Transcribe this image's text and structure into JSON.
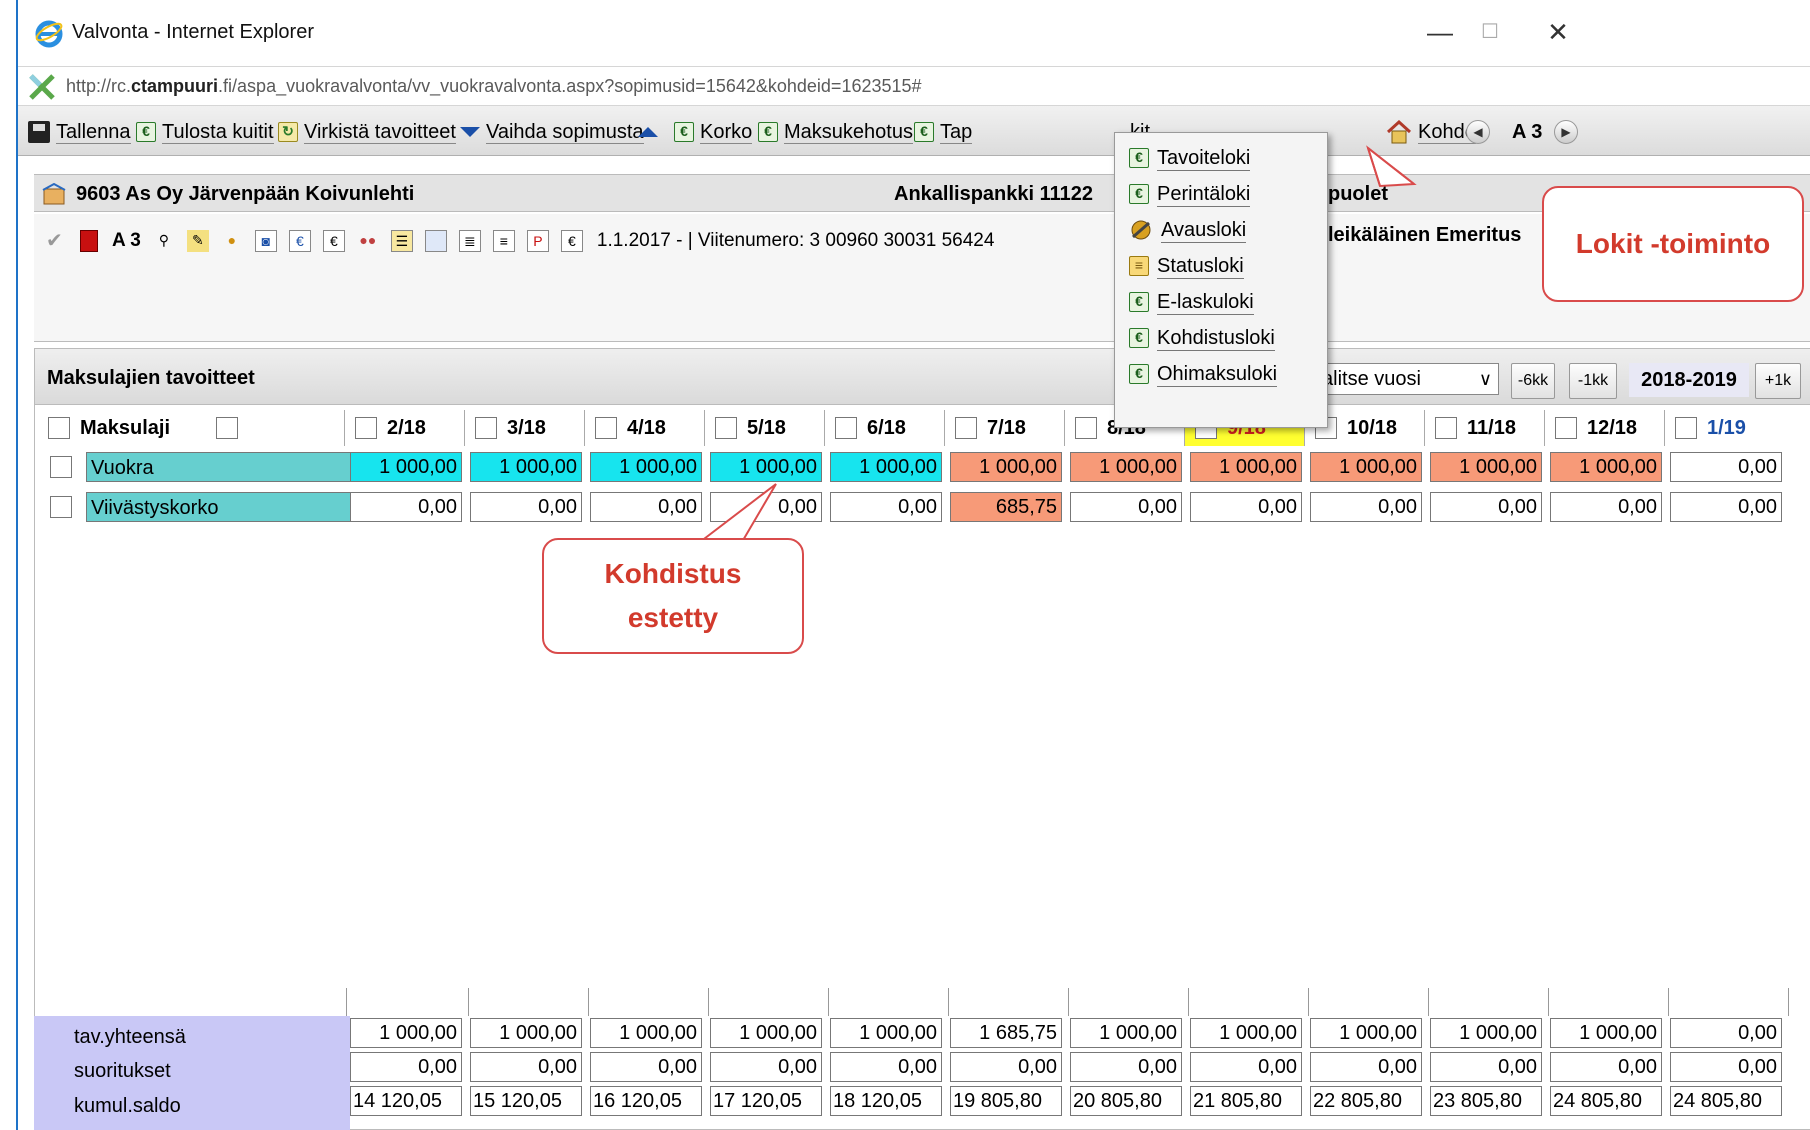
{
  "window": {
    "title": "Valvonta - Internet Explorer",
    "minimize": "—",
    "maximize": "☐",
    "close": "✕"
  },
  "address": {
    "prefix": "http://rc.",
    "host_bold": "ctampuuri",
    "suffix": ".fi/aspa_vuokravalvonta/vv_vuokravalvonta.aspx?sopimusid=15642&kohdeid=1623515#"
  },
  "toolbar": {
    "tallenna": "Tallenna",
    "tulosta": "Tulosta kuitit",
    "virkista": "Virkistä tavoitteet",
    "vaihda": "Vaihda sopimusta",
    "korko": "Korko",
    "maksukehotus": "Maksukehotus",
    "tapahtuma": "Tap",
    "lokit": "kit",
    "kohde": "Kohde",
    "a3": "A 3"
  },
  "header": {
    "title": "9603 As Oy Järvenpään Koivunlehti",
    "bank": "Ankallispankki 11122",
    "puolet": "puolet"
  },
  "info": {
    "a3": "A 3",
    "text": "1.1.2017 - | Viitenumero: 3 00960 30031 56424",
    "person": "leikäläinen Emeritus"
  },
  "panel": {
    "title": "Maksulajien tavoitteet",
    "year_select": "alitse vuosi",
    "btn_m6": "-6kk",
    "btn_m1": "-1kk",
    "year": "2018-2019",
    "btn_p1": "+1k",
    "btn_p6": "+"
  },
  "columns": {
    "maksulaji": "Maksulaji",
    "months": [
      "2/18",
      "3/18",
      "4/18",
      "5/18",
      "6/18",
      "7/18",
      "8/18",
      "9/18",
      "10/18",
      "11/18",
      "12/18",
      "1/19"
    ]
  },
  "rows": [
    {
      "label": "Vuokra",
      "values": [
        "1 000,00",
        "1 000,00",
        "1 000,00",
        "1 000,00",
        "1 000,00",
        "1 000,00",
        "1 000,00",
        "1 000,00",
        "1 000,00",
        "1 000,00",
        "1 000,00",
        "0,00"
      ]
    },
    {
      "label": "Viivästyskorko",
      "values": [
        "0,00",
        "0,00",
        "0,00",
        "0,00",
        "0,00",
        "685,75",
        "0,00",
        "0,00",
        "0,00",
        "0,00",
        "0,00",
        "0,00"
      ]
    }
  ],
  "totals": {
    "labels": [
      "tav.yhteensä",
      "suoritukset",
      "kumul.saldo"
    ],
    "tav": [
      "1 000,00",
      "1 000,00",
      "1 000,00",
      "1 000,00",
      "1 000,00",
      "1 685,75",
      "1 000,00",
      "1 000,00",
      "1 000,00",
      "1 000,00",
      "1 000,00",
      "0,00"
    ],
    "suoritukset": [
      "0,00",
      "0,00",
      "0,00",
      "0,00",
      "0,00",
      "0,00",
      "0,00",
      "0,00",
      "0,00",
      "0,00",
      "0,00",
      "0,00"
    ],
    "kumul": [
      "14 120,05",
      "15 120,05",
      "16 120,05",
      "17 120,05",
      "18 120,05",
      "19 805,80",
      "20 805,80",
      "21 805,80",
      "22 805,80",
      "23 805,80",
      "24 805,80",
      "24 805,80"
    ]
  },
  "menu": {
    "items": [
      "Tavoiteloki",
      "Perintäloki",
      "Avausloki",
      "Statusloki",
      "E-laskuloki",
      "Kohdistusloki",
      "Ohimaksuloki"
    ]
  },
  "callouts": {
    "lokit": "Lokit -toiminto",
    "kohdistus_1": "Kohdistus",
    "kohdistus_2": "estetty"
  },
  "colors": {
    "cyan": "#17e4ee",
    "salmon": "#f79a78",
    "teal_label": "#66cfcf",
    "totals_bg": "#c9c8f6",
    "callout_red": "#d23a2c",
    "ie_blue": "#1e73c8"
  }
}
